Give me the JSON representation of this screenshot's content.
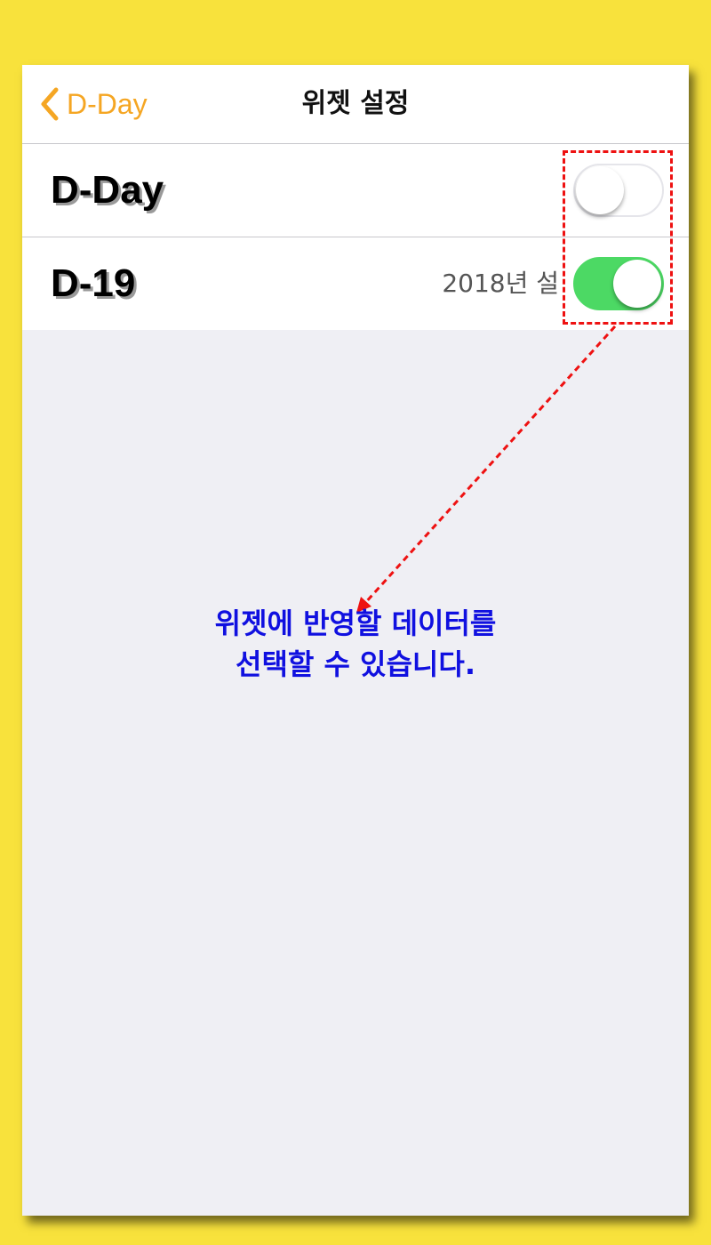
{
  "navbar": {
    "back_label": "D-Day",
    "title": "위젯 설정"
  },
  "rows": [
    {
      "title": "D-Day",
      "subtitle": "",
      "toggle_on": false
    },
    {
      "title": "D-19",
      "subtitle": "2018년 설",
      "toggle_on": true
    }
  ],
  "annotation": {
    "line1": "위젯에 반영할 데이터를",
    "line2": "선택할 수 있습니다."
  },
  "colors": {
    "background": "#f8e23c",
    "accent": "#f5a623",
    "toggle_on": "#4cd964",
    "annotation_text": "#1010e0",
    "annotation_highlight": "#ee1111"
  }
}
